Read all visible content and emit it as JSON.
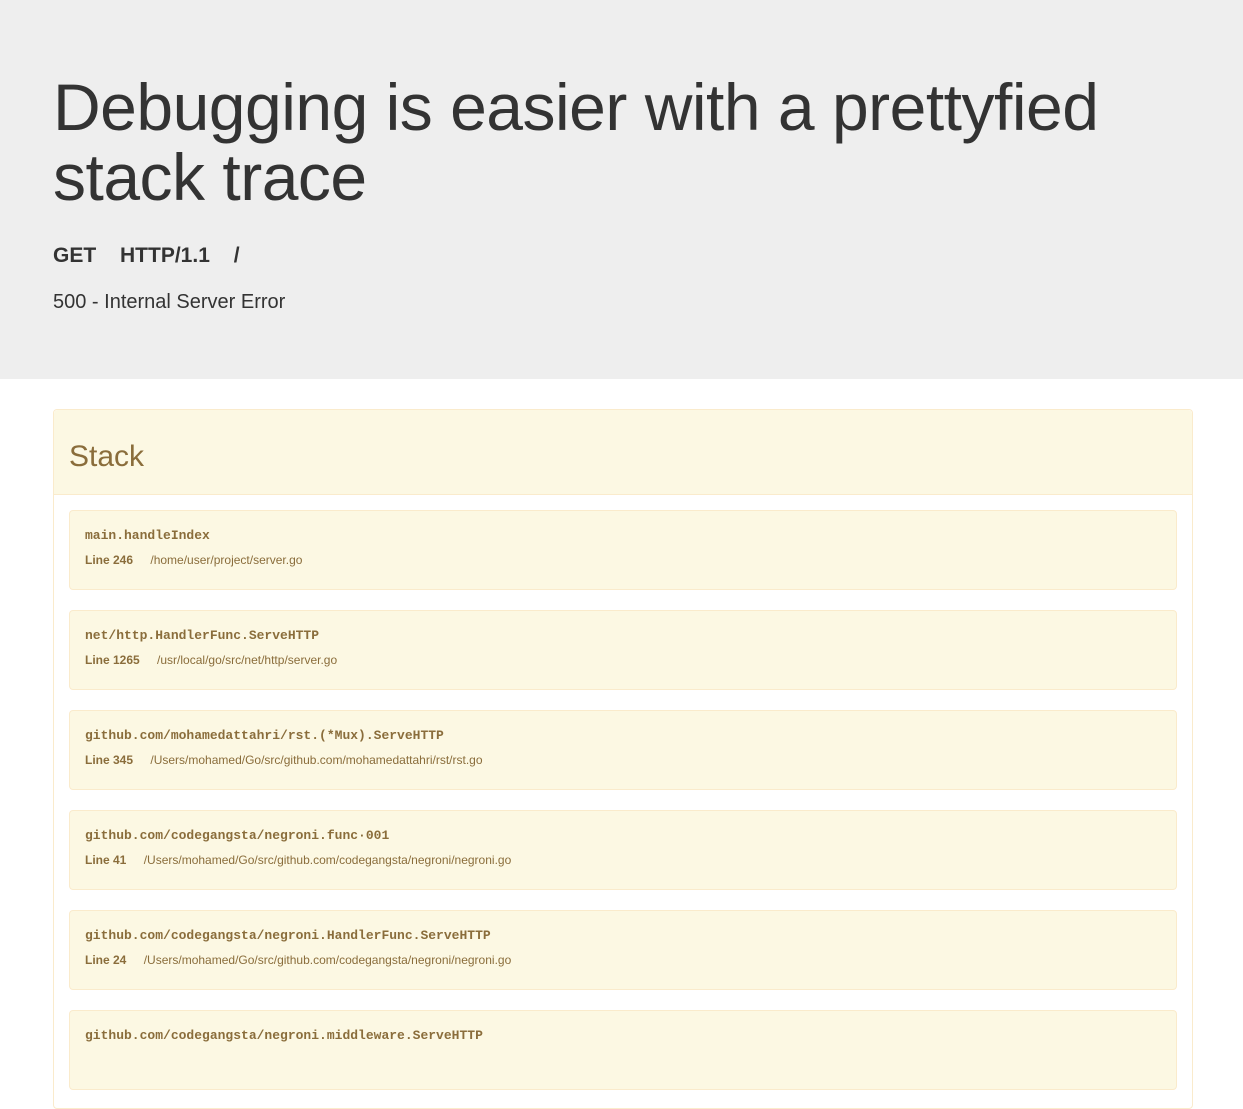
{
  "header": {
    "title": "Debugging is easier with a prettyfied stack trace",
    "method": "GET",
    "protocol": "HTTP/1.1",
    "path": "/",
    "status": "500 - Internal Server Error"
  },
  "stack": {
    "title": "Stack",
    "frames": [
      {
        "func": "main.handleIndex",
        "line": "Line 246",
        "file": "/home/user/project/server.go"
      },
      {
        "func": "net/http.HandlerFunc.ServeHTTP",
        "line": "Line 1265",
        "file": "/usr/local/go/src/net/http/server.go"
      },
      {
        "func": "github.com/mohamedattahri/rst.(*Mux).ServeHTTP",
        "line": "Line 345",
        "file": "/Users/mohamed/Go/src/github.com/mohamedattahri/rst/rst.go"
      },
      {
        "func": "github.com/codegangsta/negroni.func·001",
        "line": "Line 41",
        "file": "/Users/mohamed/Go/src/github.com/codegangsta/negroni/negroni.go"
      },
      {
        "func": "github.com/codegangsta/negroni.HandlerFunc.ServeHTTP",
        "line": "Line 24",
        "file": "/Users/mohamed/Go/src/github.com/codegangsta/negroni/negroni.go"
      },
      {
        "func": "github.com/codegangsta/negroni.middleware.ServeHTTP",
        "line": "",
        "file": ""
      }
    ]
  },
  "colors": {
    "header_bg": "#eeeeee",
    "panel_bg": "#fcf8e3",
    "panel_border": "#faebcc",
    "panel_text": "#8a6d3b"
  }
}
